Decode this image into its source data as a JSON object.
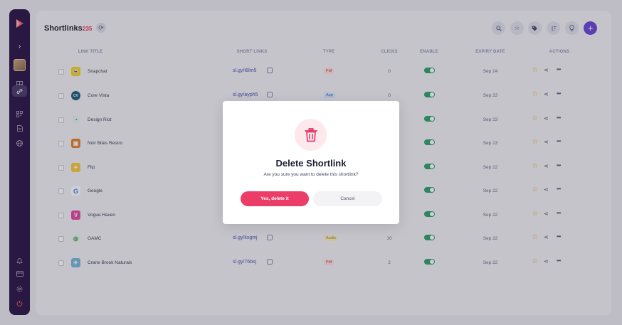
{
  "header": {
    "title": "Shortlinks",
    "count": "235"
  },
  "columns": {
    "title": "LINK TITLE",
    "short": "SHORT LINKS",
    "type": "TYPE",
    "clicks": "CLICKS",
    "enable": "ENABLE",
    "expiry": "EXPIRY DATE",
    "actions": "ACTIONS"
  },
  "rows": [
    {
      "title": "Snapchat",
      "short": "sl.gy/t8lm5",
      "type": "Pdf",
      "clicks": "0",
      "enabled": true,
      "expiry": "Sep 24",
      "logo_color": "#f7d90a",
      "logo_icon": "ghost-icon"
    },
    {
      "title": "Core Vista",
      "short": "sl.gy/ayph5",
      "type": "App",
      "clicks": "0",
      "enabled": true,
      "expiry": "Sep 23",
      "logo_color": "#1f5f7a",
      "logo_icon": "cv-icon"
    },
    {
      "title": "Design Riot",
      "short": "",
      "type": "",
      "clicks": "",
      "enabled": true,
      "expiry": "Sep 23",
      "logo_color": "#e8f3ef",
      "logo_icon": "riot-icon"
    },
    {
      "title": "Noir Bites Restro",
      "short": "",
      "type": "",
      "clicks": "",
      "enabled": true,
      "expiry": "Sep 23",
      "logo_color": "#e2832b",
      "logo_icon": "restro-icon"
    },
    {
      "title": "Flip",
      "short": "",
      "type": "",
      "clicks": "",
      "enabled": true,
      "expiry": "Sep 22",
      "logo_color": "#f6c93b",
      "logo_icon": "flip-icon"
    },
    {
      "title": "Google",
      "short": "",
      "type": "",
      "clicks": "",
      "enabled": true,
      "expiry": "Sep 22",
      "logo_color": "#ffffff",
      "logo_icon": "google-icon"
    },
    {
      "title": "Vogue Haven",
      "short": "",
      "type": "",
      "clicks": "",
      "enabled": true,
      "expiry": "Sep 22",
      "logo_color": "#e24aa0",
      "logo_icon": "vogue-icon"
    },
    {
      "title": "GAMC",
      "short": "sl.gy/kxgmj",
      "type": "Audio",
      "clicks": "10",
      "enabled": true,
      "expiry": "Sep 22",
      "logo_color": "#e9f7e4",
      "logo_icon": "gamc-icon"
    },
    {
      "title": "Crane Brook Naturals",
      "short": "sl.gy/76bsj",
      "type": "Pdf",
      "clicks": "2",
      "enabled": true,
      "expiry": "Sep 22",
      "logo_color": "#7ab8d8",
      "logo_icon": "crane-icon"
    }
  ],
  "type_colors": {
    "Pdf": {
      "bg": "#fde2e2",
      "fg": "#d23b3b"
    },
    "App": {
      "bg": "#dbe9fb",
      "fg": "#2d6fc9"
    },
    "Audio": {
      "bg": "#fbf0c8",
      "fg": "#b08810"
    }
  },
  "modal": {
    "title": "Delete Shortlink",
    "message": "Are you sure you want to delete this shortlink?",
    "confirm_label": "Yes, delete it",
    "cancel_label": "Cancel",
    "icon": "trash-icon",
    "accent_color": "#ec3d68"
  },
  "sidebar_icons": [
    "logo-icon",
    "chevron-right-icon",
    "avatar",
    "dashboard-icon",
    "link-icon",
    "qr-code-icon",
    "document-icon",
    "globe-icon",
    "bell-icon",
    "card-icon",
    "settings-icon",
    "power-icon"
  ]
}
